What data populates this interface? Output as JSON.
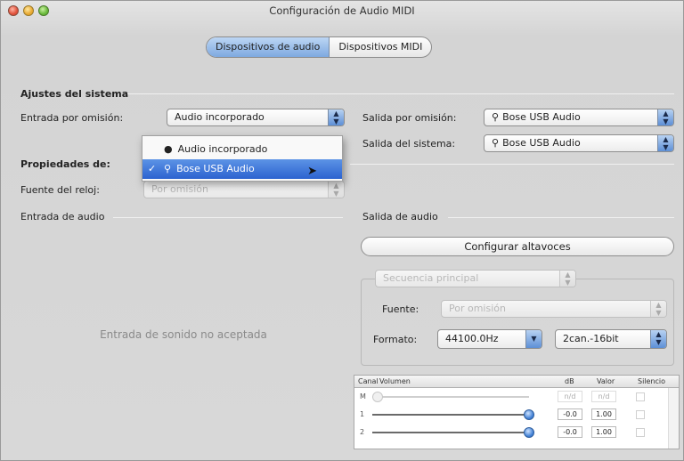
{
  "window": {
    "title": "Configuración de Audio MIDI"
  },
  "tabs": [
    {
      "label": "Dispositivos de audio"
    },
    {
      "label": "Dispositivos MIDI"
    }
  ],
  "system": {
    "title": "Ajustes del sistema",
    "input_label": "Entrada por omisión:",
    "input_value": "Audio incorporado",
    "output_label": "Salida por omisión:",
    "output_value": "Bose USB Audio",
    "system_output_label": "Salida del sistema:",
    "system_output_value": "Bose USB Audio"
  },
  "menu": {
    "items": [
      {
        "label": "Audio incorporado",
        "icon": "apple-icon"
      },
      {
        "label": "Bose USB Audio",
        "icon": "usb-icon"
      }
    ]
  },
  "properties": {
    "title": "Propiedades de:",
    "clock_label": "Fuente del reloj:",
    "clock_value": "Por omisión"
  },
  "audio_in": {
    "title": "Entrada de audio",
    "message": "Entrada de sonido no aceptada"
  },
  "audio_out": {
    "title": "Salida de audio",
    "configure_button": "Configurar altavoces",
    "stream_value": "Secuencia principal",
    "source_label": "Fuente:",
    "source_value": "Por omisión",
    "format_label": "Formato:",
    "format_rate": "44100.0Hz",
    "format_channels": "2can.-16bit"
  },
  "table": {
    "headers": {
      "channel": "Canal",
      "volume": "Volumen",
      "db": "dB",
      "value": "Valor",
      "mute": "Silencio"
    },
    "rows": [
      {
        "channel": "M",
        "db": "n/d",
        "value": "n/d",
        "level": 0,
        "enabled": false
      },
      {
        "channel": "1",
        "db": "-0.0",
        "value": "1.00",
        "level": 1,
        "enabled": true
      },
      {
        "channel": "2",
        "db": "-0.0",
        "value": "1.00",
        "level": 1,
        "enabled": true
      }
    ]
  }
}
